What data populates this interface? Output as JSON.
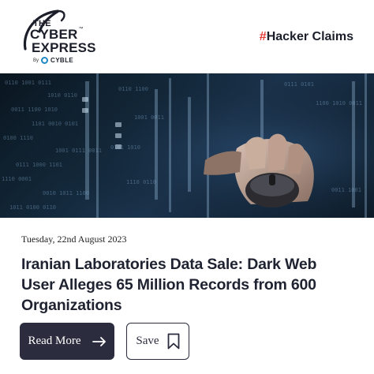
{
  "header": {
    "logo": {
      "line1": "THE",
      "line2": "CYBER",
      "line3": "EXPRESS",
      "by": "By",
      "brand": "CYBLE"
    },
    "category_hash": "#",
    "category_label": "Hacker Claims"
  },
  "hero": {
    "image_alt": "hand on computer mouse over dark binary code background"
  },
  "article": {
    "date": "Tuesday, 22nd August 2023",
    "title": "Iranian Laboratories Data Sale: Dark Web User Alleges 65 Million Records from 600 Organizations"
  },
  "actions": {
    "read_more_label": "Read More",
    "save_label": "Save"
  },
  "colors": {
    "accent_red": "#e53935",
    "button_dark": "#2b2d3e",
    "text_dark": "#1f2230",
    "cyble_blue": "#1e88c7"
  },
  "icons": {
    "read_more": "arrow-right-icon",
    "save": "bookmark-icon"
  }
}
